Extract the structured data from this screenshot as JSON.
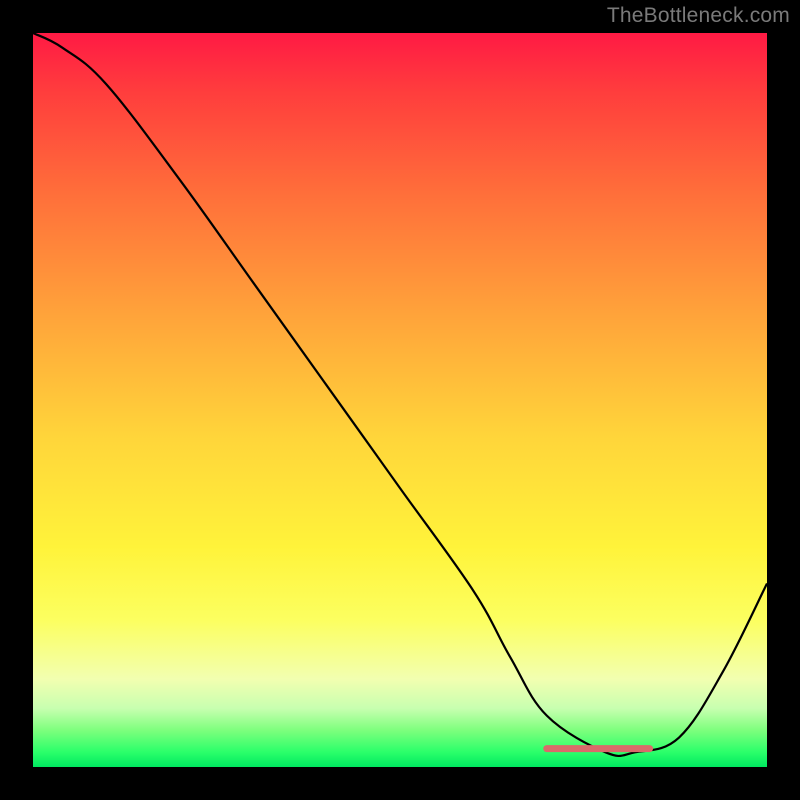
{
  "watermark": "TheBottleneck.com",
  "colors": {
    "curve_stroke": "#000000",
    "flat_segment_stroke": "#d96a6a",
    "background_frame": "#000000"
  },
  "chart_data": {
    "type": "line",
    "title": "",
    "xlabel": "",
    "ylabel": "",
    "xlim": [
      0,
      100
    ],
    "ylim": [
      0,
      100
    ],
    "series": [
      {
        "name": "bottleneck-curve",
        "x": [
          0,
          4,
          10,
          20,
          30,
          40,
          50,
          60,
          65,
          70,
          78,
          82,
          88,
          94,
          100
        ],
        "values": [
          100,
          98,
          93,
          80,
          66,
          52,
          38,
          24,
          15,
          7,
          2,
          2,
          4,
          13,
          25
        ]
      }
    ],
    "annotations": {
      "flat_segment": {
        "x_start": 70,
        "x_end": 84,
        "y": 2.5
      }
    }
  }
}
